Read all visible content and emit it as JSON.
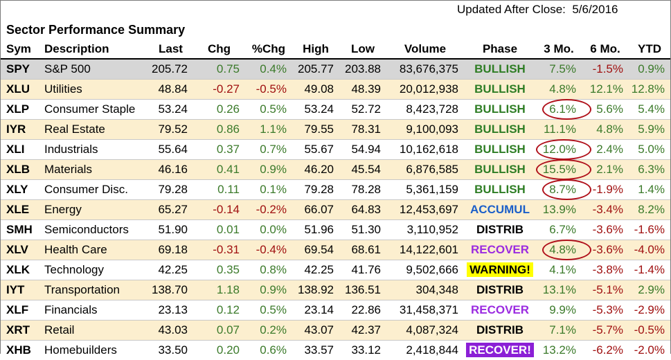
{
  "updated": "Updated After Close:  5/6/2016",
  "title": "Sector Performance Summary",
  "columns": [
    "Sym",
    "Description",
    "Last",
    "Chg",
    "%Chg",
    "High",
    "Low",
    "Volume",
    "Phase",
    "3 Mo.",
    "6 Mo.",
    "YTD"
  ],
  "rows": [
    {
      "sym": "SPY",
      "desc": "S&P 500",
      "last": "205.72",
      "chg": "0.75",
      "pct": "0.4%",
      "high": "205.77",
      "low": "203.88",
      "volume": "83,676,375",
      "phase": "BULLISH",
      "m3": "7.5%",
      "m6": "-1.5%",
      "ytd": "0.9%"
    },
    {
      "sym": "XLU",
      "desc": "Utilities",
      "last": "48.84",
      "chg": "-0.27",
      "pct": "-0.5%",
      "high": "49.08",
      "low": "48.39",
      "volume": "20,012,938",
      "phase": "BULLISH",
      "m3": "4.8%",
      "m6": "12.1%",
      "ytd": "12.8%"
    },
    {
      "sym": "XLP",
      "desc": "Consumer Staple",
      "last": "53.24",
      "chg": "0.26",
      "pct": "0.5%",
      "high": "53.24",
      "low": "52.72",
      "volume": "8,423,728",
      "phase": "BULLISH",
      "m3": "6.1%",
      "m6": "5.6%",
      "ytd": "5.4%"
    },
    {
      "sym": "IYR",
      "desc": "Real Estate",
      "last": "79.52",
      "chg": "0.86",
      "pct": "1.1%",
      "high": "79.55",
      "low": "78.31",
      "volume": "9,100,093",
      "phase": "BULLISH",
      "m3": "11.1%",
      "m6": "4.8%",
      "ytd": "5.9%"
    },
    {
      "sym": "XLI",
      "desc": "Industrials",
      "last": "55.64",
      "chg": "0.37",
      "pct": "0.7%",
      "high": "55.67",
      "low": "54.94",
      "volume": "10,162,618",
      "phase": "BULLISH",
      "m3": "12.0%",
      "m6": "2.4%",
      "ytd": "5.0%"
    },
    {
      "sym": "XLB",
      "desc": "Materials",
      "last": "46.16",
      "chg": "0.41",
      "pct": "0.9%",
      "high": "46.20",
      "low": "45.54",
      "volume": "6,876,585",
      "phase": "BULLISH",
      "m3": "15.5%",
      "m6": "2.1%",
      "ytd": "6.3%"
    },
    {
      "sym": "XLY",
      "desc": "Consumer Disc.",
      "last": "79.28",
      "chg": "0.11",
      "pct": "0.1%",
      "high": "79.28",
      "low": "78.28",
      "volume": "5,361,159",
      "phase": "BULLISH",
      "m3": "8.7%",
      "m6": "-1.9%",
      "ytd": "1.4%"
    },
    {
      "sym": "XLE",
      "desc": "Energy",
      "last": "65.27",
      "chg": "-0.14",
      "pct": "-0.2%",
      "high": "66.07",
      "low": "64.83",
      "volume": "12,453,697",
      "phase": "ACCUMUL",
      "m3": "13.9%",
      "m6": "-3.4%",
      "ytd": "8.2%"
    },
    {
      "sym": "SMH",
      "desc": "Semiconductors",
      "last": "51.90",
      "chg": "0.01",
      "pct": "0.0%",
      "high": "51.96",
      "low": "51.30",
      "volume": "3,110,952",
      "phase": "DISTRIB",
      "m3": "6.7%",
      "m6": "-3.6%",
      "ytd": "-1.6%"
    },
    {
      "sym": "XLV",
      "desc": "Health Care",
      "last": "69.18",
      "chg": "-0.31",
      "pct": "-0.4%",
      "high": "69.54",
      "low": "68.61",
      "volume": "14,122,601",
      "phase": "RECOVER",
      "m3": "4.8%",
      "m6": "-3.6%",
      "ytd": "-4.0%"
    },
    {
      "sym": "XLK",
      "desc": "Technology",
      "last": "42.25",
      "chg": "0.35",
      "pct": "0.8%",
      "high": "42.25",
      "low": "41.76",
      "volume": "9,502,666",
      "phase": "WARNING!",
      "m3": "4.1%",
      "m6": "-3.8%",
      "ytd": "-1.4%"
    },
    {
      "sym": "IYT",
      "desc": "Transportation",
      "last": "138.70",
      "chg": "1.18",
      "pct": "0.9%",
      "high": "138.92",
      "low": "136.51",
      "volume": "304,348",
      "phase": "DISTRIB",
      "m3": "13.1%",
      "m6": "-5.1%",
      "ytd": "2.9%"
    },
    {
      "sym": "XLF",
      "desc": "Financials",
      "last": "23.13",
      "chg": "0.12",
      "pct": "0.5%",
      "high": "23.14",
      "low": "22.86",
      "volume": "31,458,371",
      "phase": "RECOVER",
      "m3": "9.9%",
      "m6": "-5.3%",
      "ytd": "-2.9%"
    },
    {
      "sym": "XRT",
      "desc": "Retail",
      "last": "43.03",
      "chg": "0.07",
      "pct": "0.2%",
      "high": "43.07",
      "low": "42.37",
      "volume": "4,087,324",
      "phase": "DISTRIB",
      "m3": "7.1%",
      "m6": "-5.7%",
      "ytd": "-0.5%"
    },
    {
      "sym": "XHB",
      "desc": "Homebuilders",
      "last": "33.50",
      "chg": "0.20",
      "pct": "0.6%",
      "high": "33.57",
      "low": "33.12",
      "volume": "2,418,844",
      "phase": "RECOVER!",
      "m3": "13.2%",
      "m6": "-6.2%",
      "ytd": "-2.0%"
    }
  ],
  "circled_3mo": [
    "XLP",
    "XLI",
    "XLB",
    "XLY",
    "XLV"
  ],
  "colors": {
    "positive": "#3b7a2a",
    "negative": "#a01010",
    "bullish": "#2e7d24",
    "accumul": "#1b5fc9",
    "recover": "#9b2be0",
    "warning_bg": "#ffff00",
    "recover_hl_bg": "#8b1fd6",
    "row_tan": "#fcefcf",
    "row_gray": "#d6d6d6",
    "circle": "#b0101a"
  }
}
